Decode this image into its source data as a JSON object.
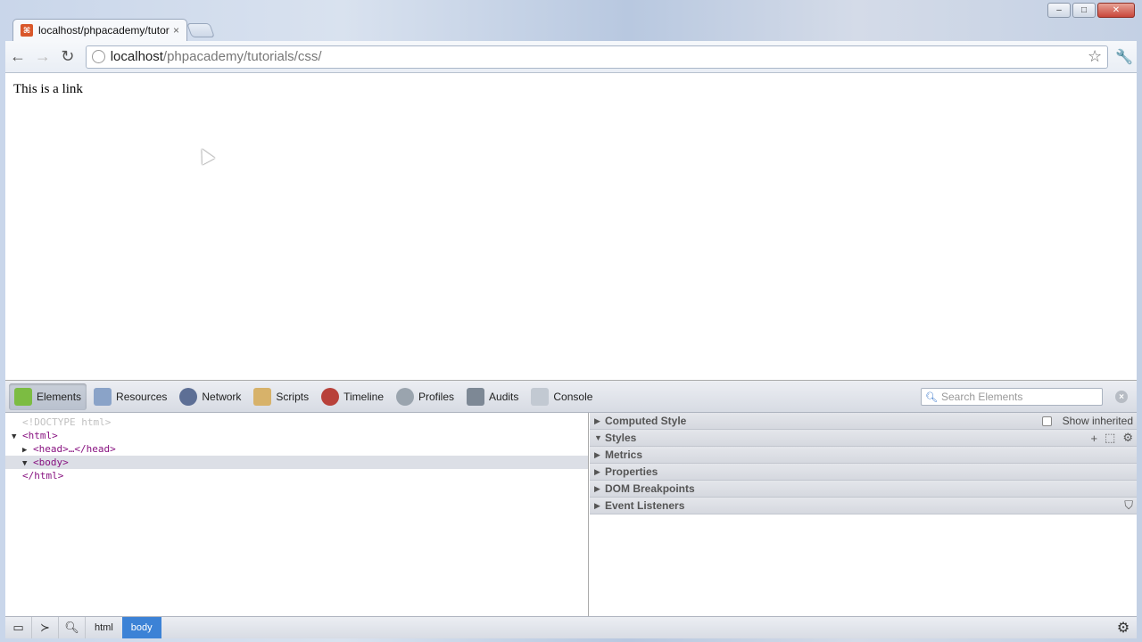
{
  "window": {
    "minimize": "–",
    "maximize": "□",
    "close": "✕"
  },
  "tab": {
    "title": "localhost/phpacademy/tutorials/css/",
    "close": "×"
  },
  "toolbar": {
    "url_host": "localhost",
    "url_path": "/phpacademy/tutorials/css/"
  },
  "page": {
    "link_text": "This is a link"
  },
  "devtools": {
    "tabs": [
      {
        "label": "Elements",
        "icon": "elements-icon"
      },
      {
        "label": "Resources",
        "icon": "resources-icon"
      },
      {
        "label": "Network",
        "icon": "network-icon"
      },
      {
        "label": "Scripts",
        "icon": "scripts-icon"
      },
      {
        "label": "Timeline",
        "icon": "timeline-icon"
      },
      {
        "label": "Profiles",
        "icon": "profiles-icon"
      },
      {
        "label": "Audits",
        "icon": "audits-icon"
      },
      {
        "label": "Console",
        "icon": "console-icon"
      }
    ],
    "search_placeholder": "Search Elements",
    "dom": {
      "doctype": "<!DOCTYPE html>",
      "html_open": "<html>",
      "head": "<head>…</head>",
      "body_open": "<body>",
      "html_close": "</html>"
    },
    "sidebar": {
      "computed_style": "Computed Style",
      "show_inherited": "Show inherited",
      "styles": "Styles",
      "metrics": "Metrics",
      "properties": "Properties",
      "dom_breakpoints": "DOM Breakpoints",
      "event_listeners": "Event Listeners"
    },
    "breadcrumbs": [
      "html",
      "body"
    ]
  }
}
